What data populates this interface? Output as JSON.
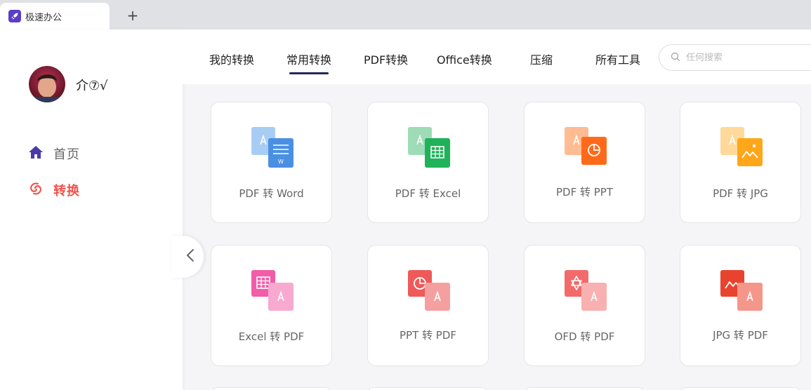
{
  "browser": {
    "tab_title": "极速办公",
    "new_tab": "+"
  },
  "sidebar": {
    "username": "介⑦√",
    "items": [
      {
        "label": "首页",
        "icon": "home-icon",
        "color": "#4a3aa8"
      },
      {
        "label": "转换",
        "icon": "convert-icon",
        "color": "#f0534b",
        "active": true
      }
    ]
  },
  "header": {
    "tabs": [
      {
        "label": "我的转换"
      },
      {
        "label": "常用转换",
        "active": true
      },
      {
        "label": "PDF转换"
      },
      {
        "label": "Office转换"
      },
      {
        "label": "压缩"
      },
      {
        "label": "所有工具"
      }
    ],
    "search_placeholder": "任何搜索"
  },
  "tools": [
    {
      "label": "PDF 转 Word",
      "icon": "pdf-to-word-icon",
      "color": "#4a90e2"
    },
    {
      "label": "PDF 转 Excel",
      "icon": "pdf-to-excel-icon",
      "color": "#1fb25a"
    },
    {
      "label": "PDF 转 PPT",
      "icon": "pdf-to-ppt-icon",
      "color": "#ff6a1a"
    },
    {
      "label": "PDF 转 JPG",
      "icon": "pdf-to-jpg-icon",
      "color": "#ffa619"
    },
    {
      "label": "Excel 转 PDF",
      "icon": "excel-to-pdf-icon",
      "color": "#f25ca8"
    },
    {
      "label": "PPT 转 PDF",
      "icon": "ppt-to-pdf-icon",
      "color": "#ee5a5a"
    },
    {
      "label": "OFD 转 PDF",
      "icon": "ofd-to-pdf-icon",
      "color": "#f36a6a"
    },
    {
      "label": "JPG 转 PDF",
      "icon": "jpg-to-pdf-icon",
      "color": "#e8432e"
    }
  ]
}
